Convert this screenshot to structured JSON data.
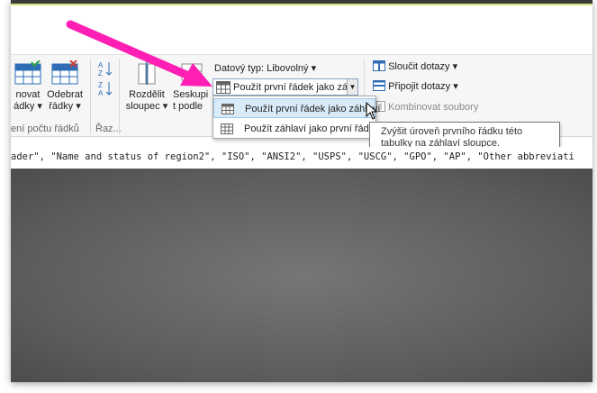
{
  "ribbon": {
    "remove_rows_label_1": "novat",
    "remove_rows_label_2": "ádky",
    "keep_rows_label_1": "Odebrat",
    "keep_rows_label_2": "řádky",
    "group_reduce_rows": "ení počtu řádků",
    "group_sort": "Řaz...",
    "split_column_1": "Rozdělit",
    "split_column_2": "sloupec",
    "group_by_1": "Seskupi",
    "group_by_2": "t podle",
    "data_type": "Datový typ: Libovolný",
    "use_first_row_combo": "Použít první řádek jako záhlaví",
    "merge_queries": "Sloučit dotazy",
    "append_queries": "Připojit dotazy",
    "combine_files": "Kombinovat soubory"
  },
  "dropdown": {
    "items": [
      {
        "label": "Použít první řádek jako záhlaví",
        "highlighted": true
      },
      {
        "label": "Použít záhlaví jako první řádek",
        "highlighted": false
      }
    ]
  },
  "tooltip": {
    "line1": "Zvýšit úroveň prvního řádku této",
    "line2": "tabulky na záhlaví sloupce."
  },
  "formula": {
    "text": "ader\", \"Name and status of region2\", \"ISO\", \"ANSI2\", \"USPS\", \"USCG\", \"GPO\", \"AP\", \"Other abbreviati"
  },
  "colors": {
    "accent_arrow": "#ff1fb4",
    "highlight": "#d9ebf9",
    "ribbon_bg": "#f6f6f6"
  }
}
